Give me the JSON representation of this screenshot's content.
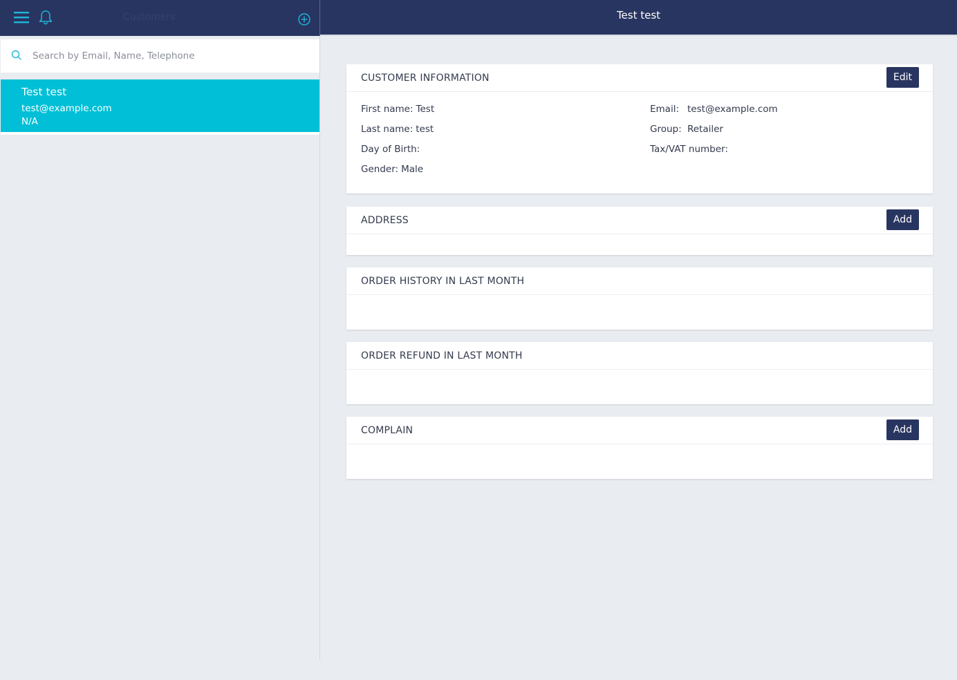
{
  "sidebar_header": {
    "title": "Customers",
    "menu_icon": "menu-icon",
    "bell_icon": "bell-icon",
    "add_icon": "plus-circle-icon"
  },
  "main_header": {
    "title": "Test test"
  },
  "search": {
    "placeholder": "Search by Email, Name, Telephone",
    "value": ""
  },
  "customers": [
    {
      "name": "Test test",
      "email": "test@example.com",
      "telephone": "N/A"
    }
  ],
  "customer_info": {
    "title": "CUSTOMER INFORMATION",
    "edit_label": "Edit",
    "first_name_label": "First name:",
    "first_name": "Test",
    "last_name_label": "Last name:",
    "last_name": "test",
    "dob_label": "Day of Birth:",
    "dob": "",
    "gender_label": "Gender:",
    "gender": "Male",
    "email_label": "Email:",
    "email": "test@example.com",
    "group_label": "Group:",
    "group": "Retailer",
    "tax_label": "Tax/VAT number:",
    "tax": ""
  },
  "address": {
    "title": "ADDRESS",
    "add_label": "Add"
  },
  "order_history": {
    "title": "ORDER HISTORY IN LAST MONTH"
  },
  "order_refund": {
    "title": "ORDER REFUND IN LAST MONTH"
  },
  "complain": {
    "title": "COMPLAIN",
    "add_label": "Add"
  },
  "colors": {
    "header": "#293561",
    "accent": "#00bfd6",
    "background": "#e9ecf1"
  }
}
